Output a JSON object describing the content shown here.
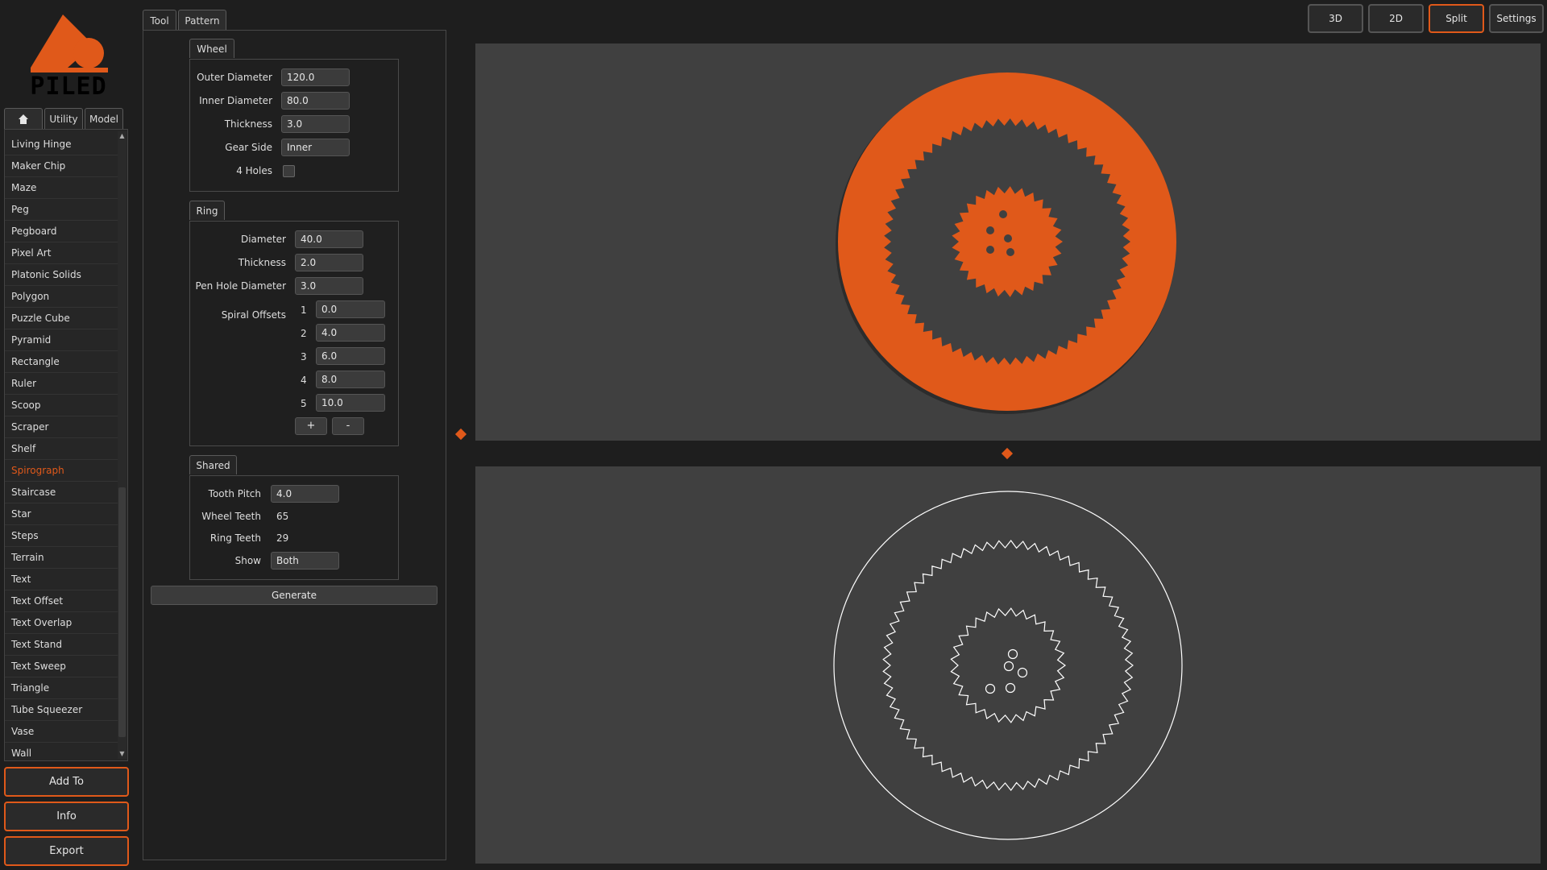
{
  "app": {
    "logo_text": "PILED"
  },
  "colors": {
    "accent": "#e0591a",
    "panel_bg": "#1f1f1f",
    "viewport_bg": "#404040",
    "field_bg": "#3b3b3b"
  },
  "sidebar": {
    "tabs": [
      {
        "icon": "home-icon"
      },
      {
        "label": "Utility"
      },
      {
        "label": "Model"
      }
    ],
    "tools": [
      "Living Hinge",
      "Maker Chip",
      "Maze",
      "Peg",
      "Pegboard",
      "Pixel Art",
      "Platonic Solids",
      "Polygon",
      "Puzzle Cube",
      "Pyramid",
      "Rectangle",
      "Ruler",
      "Scoop",
      "Scraper",
      "Shelf",
      "Spirograph",
      "Staircase",
      "Star",
      "Steps",
      "Terrain",
      "Text",
      "Text Offset",
      "Text Overlap",
      "Text Stand",
      "Text Sweep",
      "Triangle",
      "Tube Squeezer",
      "Vase",
      "Wall"
    ],
    "selected_tool": "Spirograph",
    "buttons": {
      "add_to": "Add To",
      "info": "Info",
      "export": "Export"
    }
  },
  "panel": {
    "tabs": {
      "tool": "Tool",
      "pattern": "Pattern"
    },
    "wheel": {
      "title": "Wheel",
      "outer_diameter_label": "Outer Diameter",
      "outer_diameter": "120.0",
      "inner_diameter_label": "Inner Diameter",
      "inner_diameter": "80.0",
      "thickness_label": "Thickness",
      "thickness": "3.0",
      "gear_side_label": "Gear Side",
      "gear_side": "Inner",
      "four_holes_label": "4 Holes",
      "four_holes": false
    },
    "ring": {
      "title": "Ring",
      "diameter_label": "Diameter",
      "diameter": "40.0",
      "thickness_label": "Thickness",
      "thickness": "2.0",
      "pen_hole_label": "Pen Hole Diameter",
      "pen_hole": "3.0",
      "spiral_label": "Spiral Offsets",
      "offsets": [
        {
          "index": "1",
          "value": "0.0"
        },
        {
          "index": "2",
          "value": "4.0"
        },
        {
          "index": "3",
          "value": "6.0"
        },
        {
          "index": "4",
          "value": "8.0"
        },
        {
          "index": "5",
          "value": "10.0"
        }
      ],
      "add_label": "+",
      "remove_label": "-"
    },
    "shared": {
      "title": "Shared",
      "tooth_pitch_label": "Tooth Pitch",
      "tooth_pitch": "4.0",
      "wheel_teeth_label": "Wheel Teeth",
      "wheel_teeth": "65",
      "ring_teeth_label": "Ring Teeth",
      "ring_teeth": "29",
      "show_label": "Show",
      "show": "Both"
    },
    "generate_label": "Generate"
  },
  "view_buttons": {
    "three_d": "3D",
    "two_d": "2D",
    "split": "Split",
    "settings": "Settings",
    "active": "Split"
  }
}
